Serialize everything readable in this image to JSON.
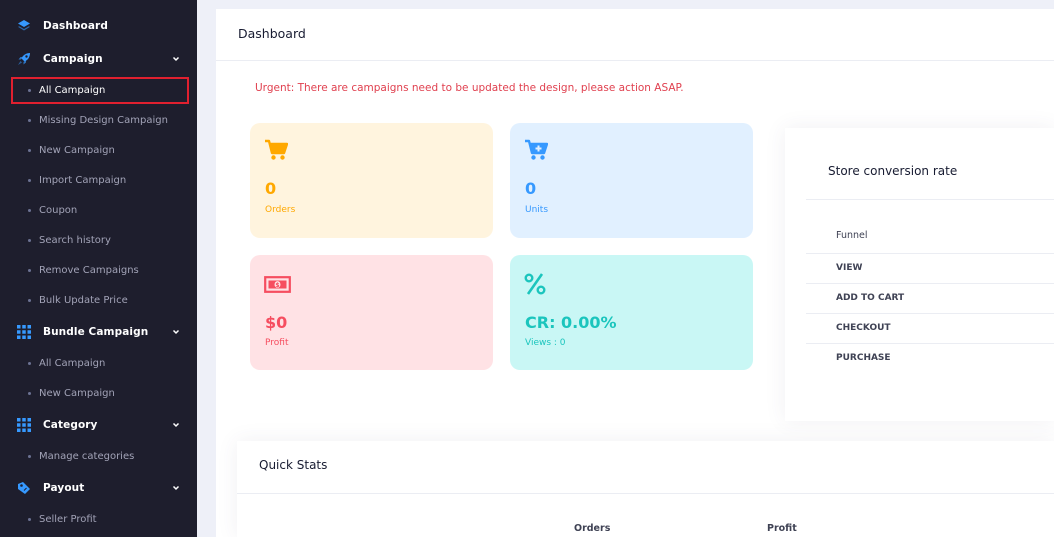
{
  "sidebar": {
    "sections": [
      {
        "label": "Dashboard",
        "icon": "layers-icon"
      },
      {
        "label": "Campaign",
        "icon": "rocket-icon"
      },
      {
        "label": "Bundle Campaign",
        "icon": "grid-icon"
      },
      {
        "label": "Category",
        "icon": "grid-icon"
      },
      {
        "label": "Payout",
        "icon": "tag-icon"
      }
    ],
    "campaign_items": [
      "All Campaign",
      "Missing Design Campaign",
      "New Campaign",
      "Import Campaign",
      "Coupon",
      "Search history",
      "Remove Campaigns",
      "Bulk Update Price"
    ],
    "bundle_items": [
      "All Campaign",
      "New Campaign"
    ],
    "category_items": [
      "Manage categories"
    ],
    "payout_items": [
      "Seller Profit"
    ]
  },
  "main": {
    "title": "Dashboard",
    "urgent": "Urgent: There are campaigns need to be updated the design, please action ASAP."
  },
  "cards": {
    "orders": {
      "value": "0",
      "label": "Orders",
      "icon": "cart-icon"
    },
    "units": {
      "value": "0",
      "label": "Units",
      "icon": "cart-plus-icon"
    },
    "profit": {
      "value": "$0",
      "label": "Profit",
      "icon": "money-icon"
    },
    "cr": {
      "value": "CR: 0.00%",
      "label": "Views : 0",
      "icon": "percent-icon"
    }
  },
  "conversion": {
    "title": "Store conversion rate",
    "header": "Funnel",
    "rows": [
      "VIEW",
      "ADD TO CART",
      "CHECKOUT",
      "PURCHASE"
    ]
  },
  "quick_stats": {
    "title": "Quick Stats",
    "columns": [
      "Orders",
      "Profit"
    ]
  },
  "colors": {
    "sidebar_bg": "#1e1e2d",
    "active_outline": "#e0202f",
    "icon_blue": "#3699ff",
    "urgent_red": "#e0404f"
  }
}
